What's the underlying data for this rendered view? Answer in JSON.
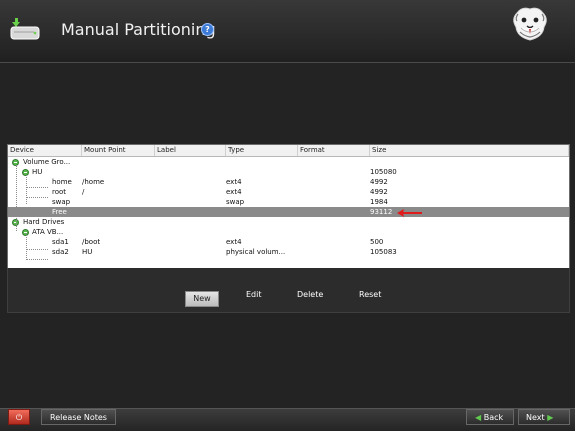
{
  "header": {
    "title": "Manual Partitioning",
    "help_label": "?"
  },
  "table": {
    "columns": [
      "Device",
      "Mount Point",
      "Label",
      "Type",
      "Format",
      "Size"
    ],
    "rows": [
      {
        "device": "Volume Gro...",
        "mount_point": "",
        "label": "",
        "type": "",
        "format": "",
        "size": "",
        "level": 0,
        "selected": false
      },
      {
        "device": "HU",
        "mount_point": "",
        "label": "",
        "type": "",
        "format": "",
        "size": "105080",
        "level": 1,
        "selected": false
      },
      {
        "device": "home",
        "mount_point": "/home",
        "label": "",
        "type": "ext4",
        "format": "",
        "size": "4992",
        "level": 2,
        "selected": false
      },
      {
        "device": "root",
        "mount_point": "/",
        "label": "",
        "type": "ext4",
        "format": "",
        "size": "4992",
        "level": 2,
        "selected": false
      },
      {
        "device": "swap",
        "mount_point": "",
        "label": "",
        "type": "swap",
        "format": "",
        "size": "1984",
        "level": 2,
        "selected": false
      },
      {
        "device": "Free",
        "mount_point": "",
        "label": "",
        "type": "",
        "format": "",
        "size": "93112",
        "level": 2,
        "selected": true
      },
      {
        "device": "Hard Drives",
        "mount_point": "",
        "label": "",
        "type": "",
        "format": "",
        "size": "",
        "level": 0,
        "selected": false
      },
      {
        "device": "ATA VB...",
        "mount_point": "",
        "label": "",
        "type": "",
        "format": "",
        "size": "",
        "level": 1,
        "selected": false
      },
      {
        "device": "sda1",
        "mount_point": "/boot",
        "label": "",
        "type": "ext4",
        "format": "",
        "size": "500",
        "level": 2,
        "selected": false
      },
      {
        "device": "sda2",
        "mount_point": "HU",
        "label": "",
        "type": "physical volum...",
        "format": "",
        "size": "105083",
        "level": 2,
        "selected": false
      }
    ]
  },
  "actions": {
    "new": "New",
    "edit": "Edit",
    "delete": "Delete",
    "reset": "Reset"
  },
  "footer": {
    "release_notes": "Release Notes",
    "back": "Back",
    "next": "Next",
    "back_icon": "green-left-arrow",
    "next_icon": "green-right-arrow"
  },
  "colors": {
    "selected_row": "#8a8a8a",
    "expand_icon": "#59b94d",
    "power_button": "#d94b3c",
    "highlight_arrow": "#e01b1b"
  }
}
